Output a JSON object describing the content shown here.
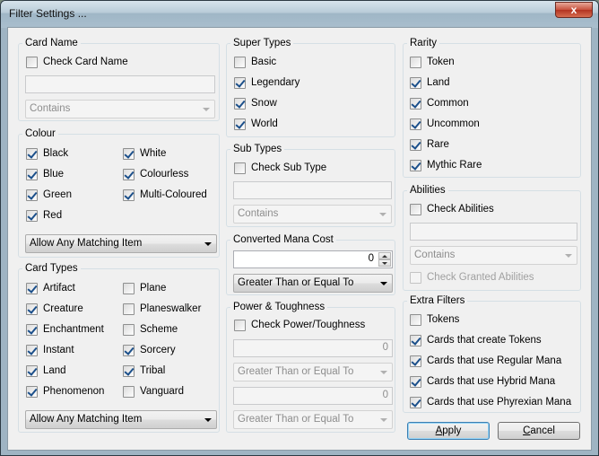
{
  "window": {
    "title": "Filter Settings ...",
    "close_glyph": "x"
  },
  "card_name": {
    "legend": "Card Name",
    "check_label": "Check Card Name",
    "checked": false,
    "text_value": "",
    "match_mode": "Contains"
  },
  "colour": {
    "legend": "Colour",
    "items": [
      {
        "label": "Black",
        "checked": true
      },
      {
        "label": "White",
        "checked": true
      },
      {
        "label": "Blue",
        "checked": true
      },
      {
        "label": "Colourless",
        "checked": true
      },
      {
        "label": "Green",
        "checked": true
      },
      {
        "label": "Multi-Coloured",
        "checked": true
      },
      {
        "label": "Red",
        "checked": true
      }
    ],
    "match_mode": "Allow Any Matching Item"
  },
  "card_types": {
    "legend": "Card Types",
    "items": [
      {
        "label": "Artifact",
        "checked": true
      },
      {
        "label": "Plane",
        "checked": false
      },
      {
        "label": "Creature",
        "checked": true
      },
      {
        "label": "Planeswalker",
        "checked": false
      },
      {
        "label": "Enchantment",
        "checked": true
      },
      {
        "label": "Scheme",
        "checked": false
      },
      {
        "label": "Instant",
        "checked": true
      },
      {
        "label": "Sorcery",
        "checked": true
      },
      {
        "label": "Land",
        "checked": true
      },
      {
        "label": "Tribal",
        "checked": true
      },
      {
        "label": "Phenomenon",
        "checked": true
      },
      {
        "label": "Vanguard",
        "checked": false
      }
    ],
    "match_mode": "Allow Any Matching Item"
  },
  "super_types": {
    "legend": "Super Types",
    "items": [
      {
        "label": "Basic",
        "checked": false
      },
      {
        "label": "Legendary",
        "checked": true
      },
      {
        "label": "Snow",
        "checked": true
      },
      {
        "label": "World",
        "checked": true
      }
    ]
  },
  "sub_types": {
    "legend": "Sub Types",
    "check_label": "Check Sub Type",
    "checked": false,
    "text_value": "",
    "match_mode": "Contains"
  },
  "converted_mana_cost": {
    "legend": "Converted Mana Cost",
    "value": "0",
    "comparison": "Greater Than or Equal To"
  },
  "power_toughness": {
    "legend": "Power & Toughness",
    "check_label": "Check Power/Toughness",
    "checked": false,
    "power_value": "0",
    "power_comparison": "Greater Than or Equal To",
    "toughness_value": "0",
    "toughness_comparison": "Greater Than or Equal To"
  },
  "rarity": {
    "legend": "Rarity",
    "items": [
      {
        "label": "Token",
        "checked": false
      },
      {
        "label": "Land",
        "checked": true
      },
      {
        "label": "Common",
        "checked": true
      },
      {
        "label": "Uncommon",
        "checked": true
      },
      {
        "label": "Rare",
        "checked": true
      },
      {
        "label": "Mythic Rare",
        "checked": true
      }
    ]
  },
  "abilities": {
    "legend": "Abilities",
    "check_label": "Check Abilities",
    "checked": false,
    "text_value": "",
    "match_mode": "Contains",
    "granted_label": "Check Granted Abilities",
    "granted_checked": false
  },
  "extra_filters": {
    "legend": "Extra Filters",
    "items": [
      {
        "label": "Tokens",
        "checked": false
      },
      {
        "label": "Cards that create Tokens",
        "checked": true
      },
      {
        "label": "Cards that use Regular Mana",
        "checked": true
      },
      {
        "label": "Cards that use Hybrid Mana",
        "checked": true
      },
      {
        "label": "Cards that use Phyrexian Mana",
        "checked": true
      }
    ]
  },
  "buttons": {
    "apply_first": "A",
    "apply_rest": "pply",
    "cancel_first": "C",
    "cancel_rest": "ancel"
  }
}
